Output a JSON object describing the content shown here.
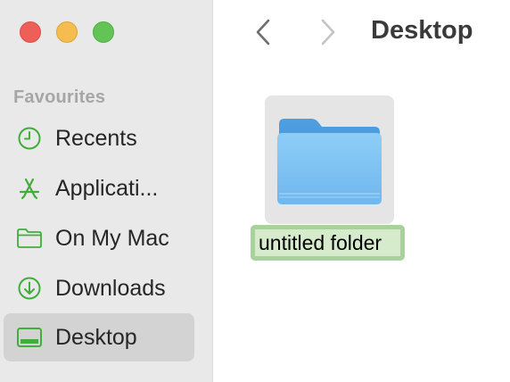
{
  "window": {
    "traffic_lights": [
      {
        "name": "close",
        "color": "#ee5f57"
      },
      {
        "name": "minimize",
        "color": "#f5bd4f"
      },
      {
        "name": "zoom",
        "color": "#61c454"
      }
    ]
  },
  "sidebar": {
    "section_header": "Favourites",
    "accent_color": "#3fae3a",
    "items": [
      {
        "label": "Recents",
        "icon": "clock-icon",
        "selected": false
      },
      {
        "label": "Applicati...",
        "icon": "applications-icon",
        "selected": false
      },
      {
        "label": "On My Mac",
        "icon": "folder-outline-icon",
        "selected": false
      },
      {
        "label": "Downloads",
        "icon": "download-circle-icon",
        "selected": false
      },
      {
        "label": "Desktop",
        "icon": "desktop-icon",
        "selected": true
      }
    ]
  },
  "toolbar": {
    "back_icon": "chevron-left-icon",
    "forward_icon": "chevron-right-icon",
    "title": "Desktop"
  },
  "content": {
    "items": [
      {
        "name": "untitled folder",
        "type": "folder",
        "renaming": true,
        "selected": true
      }
    ]
  }
}
